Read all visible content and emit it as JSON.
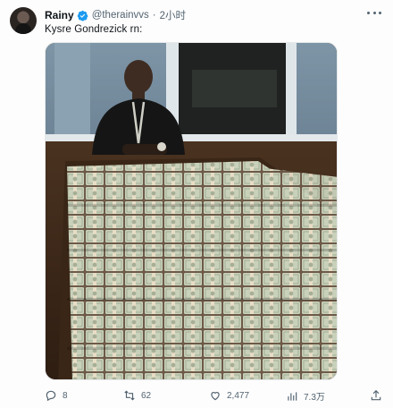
{
  "tweet": {
    "display_name": "Rainy",
    "handle": "@therainvvs",
    "separator": "·",
    "time": "2小时",
    "text": "Kysre Gondrezick rn:",
    "media_description_icon": "photo",
    "actions": {
      "replies": "8",
      "retweets": "62",
      "likes": "2,477",
      "views": "7.3万"
    }
  },
  "colors": {
    "text_primary": "#0f1419",
    "text_secondary": "#536471",
    "verified_blue": "#1d9bf0",
    "money_green": "#c8d2b4"
  },
  "icons": [
    "avatar",
    "verified-badge-icon",
    "more-icon",
    "reply-icon",
    "retweet-icon",
    "like-icon",
    "views-icon",
    "share-icon"
  ]
}
